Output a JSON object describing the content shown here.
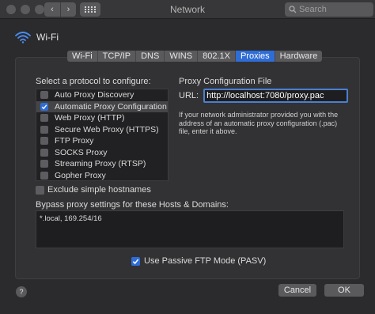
{
  "window": {
    "title": "Network",
    "search_placeholder": "Search",
    "back_glyph": "‹",
    "forward_glyph": "›"
  },
  "interface": {
    "name": "Wi-Fi",
    "icon": "wifi-icon"
  },
  "tabs": [
    {
      "label": "Wi-Fi",
      "active": false
    },
    {
      "label": "TCP/IP",
      "active": false
    },
    {
      "label": "DNS",
      "active": false
    },
    {
      "label": "WINS",
      "active": false
    },
    {
      "label": "802.1X",
      "active": false
    },
    {
      "label": "Proxies",
      "active": true
    },
    {
      "label": "Hardware",
      "active": false
    }
  ],
  "protocols": {
    "heading": "Select a protocol to configure:",
    "items": [
      {
        "label": "Auto Proxy Discovery",
        "checked": false,
        "selected": false
      },
      {
        "label": "Automatic Proxy Configuration",
        "checked": true,
        "selected": true
      },
      {
        "label": "Web Proxy (HTTP)",
        "checked": false,
        "selected": false
      },
      {
        "label": "Secure Web Proxy (HTTPS)",
        "checked": false,
        "selected": false
      },
      {
        "label": "FTP Proxy",
        "checked": false,
        "selected": false
      },
      {
        "label": "SOCKS Proxy",
        "checked": false,
        "selected": false
      },
      {
        "label": "Streaming Proxy (RTSP)",
        "checked": false,
        "selected": false
      },
      {
        "label": "Gopher Proxy",
        "checked": false,
        "selected": false
      }
    ]
  },
  "exclude_simple": {
    "label": "Exclude simple hostnames",
    "checked": false
  },
  "proxy_config": {
    "heading": "Proxy Configuration File",
    "url_label": "URL:",
    "url_value": "http://localhost:7080/proxy.pac",
    "help_text": "If your network administrator provided you with the address of an automatic proxy configuration (.pac) file, enter it above."
  },
  "bypass": {
    "heading": "Bypass proxy settings for these Hosts & Domains:",
    "value": "*.local, 169.254/16"
  },
  "passive_ftp": {
    "label": "Use Passive FTP Mode (PASV)",
    "checked": true
  },
  "buttons": {
    "help": "?",
    "cancel": "Cancel",
    "ok": "OK"
  },
  "colors": {
    "accent": "#2f6dd6",
    "background": "#2b2b2d",
    "panel": "#323234"
  }
}
